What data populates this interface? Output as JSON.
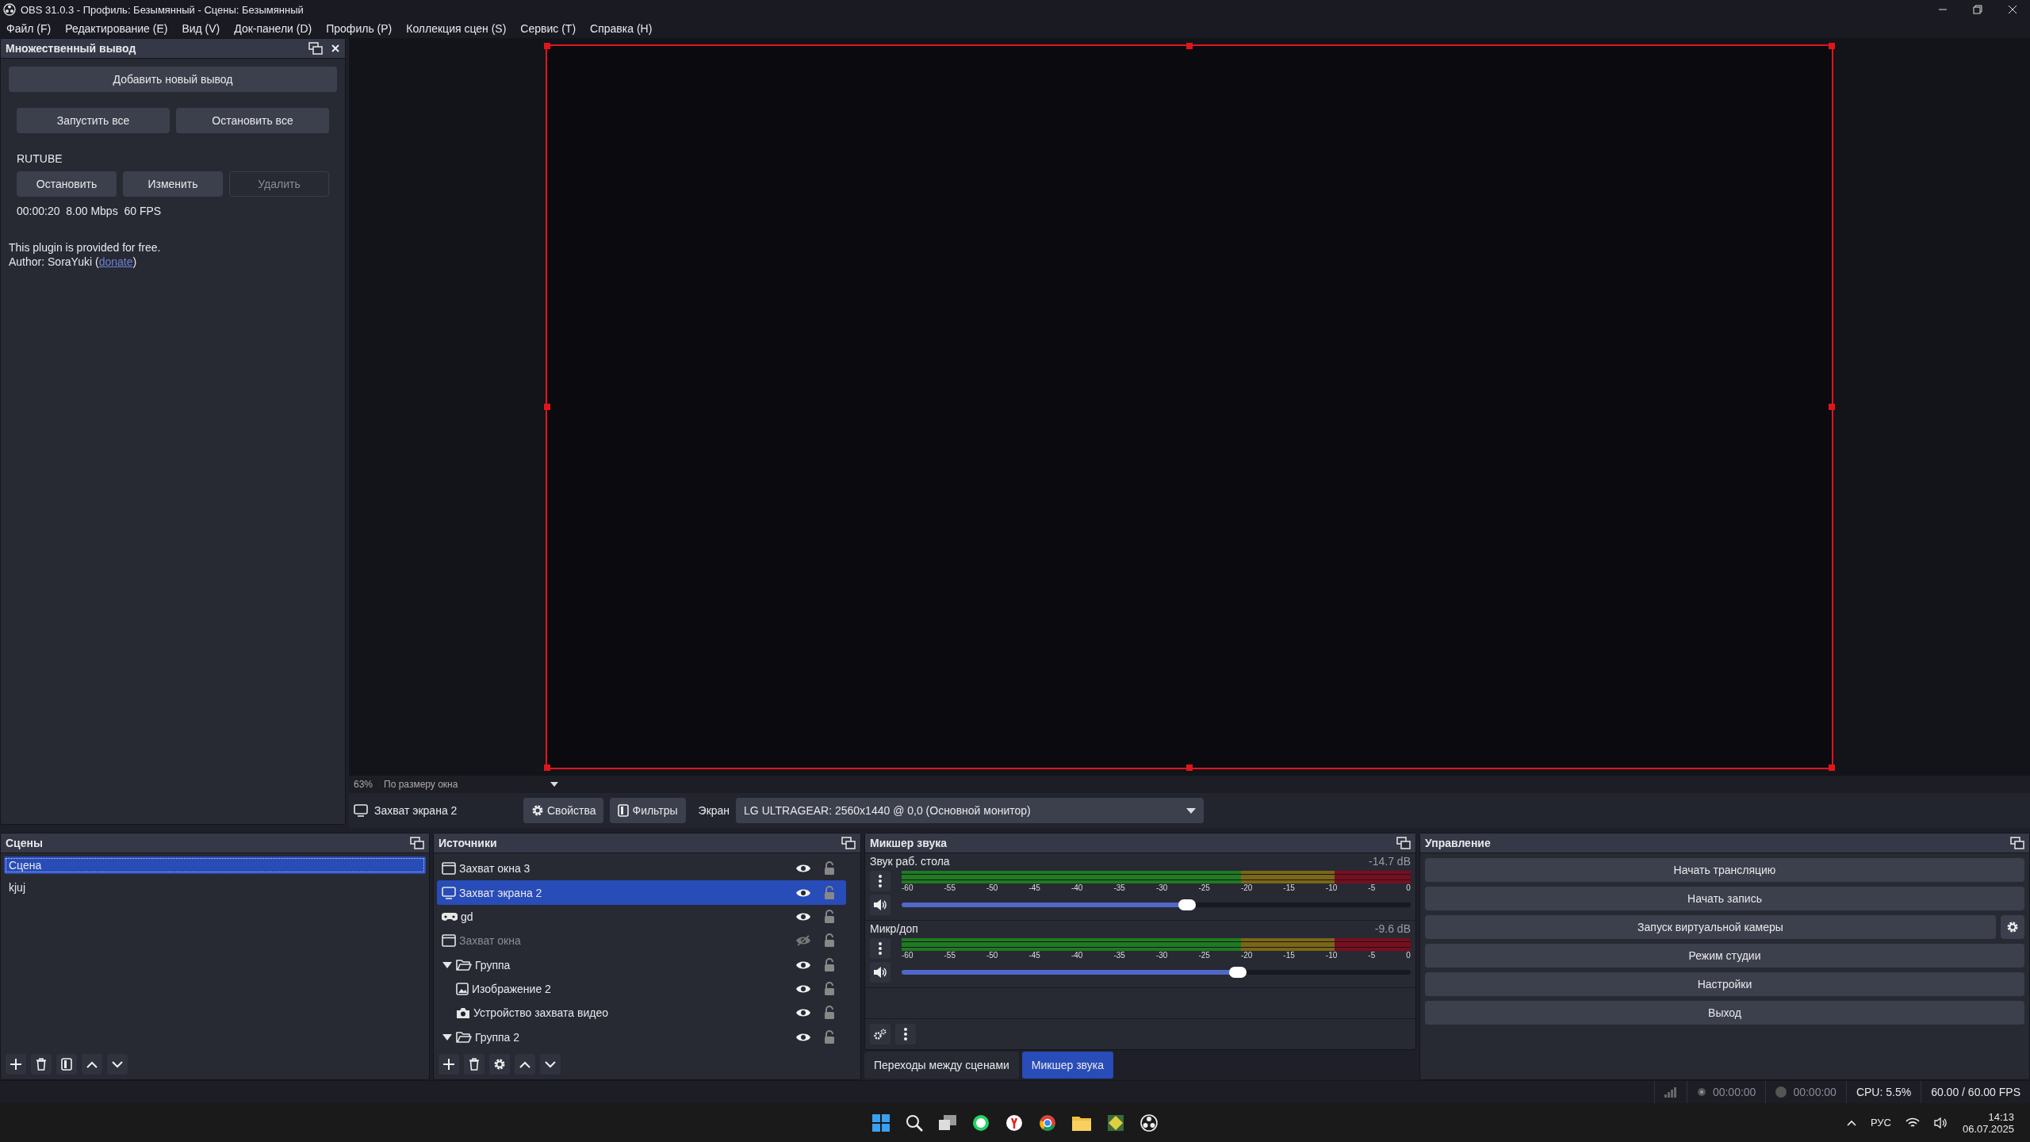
{
  "window": {
    "title": "OBS 31.0.3 - Профиль: Безымянный - Сцены: Безымянный"
  },
  "menu": [
    "Файл (F)",
    "Редактирование (E)",
    "Вид (V)",
    "Док-панели (D)",
    "Профиль (P)",
    "Коллекция сцен (S)",
    "Сервис (T)",
    "Справка (H)"
  ],
  "multi_output": {
    "title": "Множественный вывод",
    "add_button": "Добавить новый вывод",
    "start_all": "Запустить все",
    "stop_all": "Остановить все",
    "targets": [
      {
        "name": "RUTUBE",
        "buttons": [
          {
            "label": "Остановить",
            "disabled": false
          },
          {
            "label": "Изменить",
            "disabled": false
          },
          {
            "label": "Удалить",
            "disabled": true
          }
        ],
        "stats": "00:00:20  8.00 Mbps  60 FPS"
      }
    ],
    "info": "This plugin is provided for free.",
    "author_prefix": "Author: SoraYuki (",
    "author_link": "donate",
    "author_suffix": ")"
  },
  "preview": {
    "zoom": "63%",
    "scale_mode": "По размеру окна"
  },
  "source_toolbar": {
    "source_name": "Захват экрана 2",
    "properties": "Свойства",
    "filters": "Фильтры",
    "label": "Экран",
    "display": "LG ULTRAGEAR: 2560x1440 @ 0,0 (Основной монитор)"
  },
  "scenes": {
    "title": "Сцены",
    "items": [
      {
        "name": "Сцена",
        "selected": true
      },
      {
        "name": "kjuj",
        "selected": false
      }
    ]
  },
  "sources": {
    "title": "Источники",
    "items": [
      {
        "name": "Захват окна 3",
        "kind": "window",
        "visible": true,
        "selected": false
      },
      {
        "name": "Захват экрана 2",
        "kind": "display",
        "visible": true,
        "selected": true
      },
      {
        "name": "gd",
        "kind": "game",
        "visible": true,
        "selected": false
      },
      {
        "name": "Захват окна",
        "kind": "window",
        "visible": false,
        "selected": false
      },
      {
        "name": "Группа",
        "kind": "group",
        "visible": true,
        "selected": false,
        "expanded": true,
        "children": [
          {
            "name": "Изображение 2",
            "kind": "image",
            "visible": true,
            "selected": false
          },
          {
            "name": "Устройство захвата видео",
            "kind": "camera",
            "visible": true,
            "selected": false
          }
        ]
      },
      {
        "name": "Группа 2",
        "kind": "group",
        "visible": true,
        "selected": false,
        "expanded": true
      }
    ]
  },
  "mixer": {
    "title": "Микшер звука",
    "channels": [
      {
        "name": "Звук раб. стола",
        "reading": "-14.7 dB",
        "level": 0.56,
        "scale": [
          "-60",
          "-55",
          "-50",
          "-45",
          "-40",
          "-35",
          "-30",
          "-25",
          "-20",
          "-15",
          "-10",
          "-5",
          "0"
        ]
      },
      {
        "name": "Микр/доп",
        "reading": "-9.6 dB",
        "level": 0.66,
        "scale": [
          "-60",
          "-55",
          "-50",
          "-45",
          "-40",
          "-35",
          "-30",
          "-25",
          "-20",
          "-15",
          "-10",
          "-5",
          "0"
        ]
      }
    ],
    "tabs": [
      {
        "label": "Переходы между сценами",
        "selected": false
      },
      {
        "label": "Микшер звука",
        "selected": true
      }
    ]
  },
  "controls": {
    "title": "Управление",
    "buttons": [
      {
        "label": "Начать трансляцию",
        "kind": "plain"
      },
      {
        "label": "Начать запись",
        "kind": "plain"
      },
      {
        "label": "Запуск виртуальной камеры",
        "kind": "with_settings"
      },
      {
        "label": "Режим студии",
        "kind": "plain"
      },
      {
        "label": "Настройки",
        "kind": "plain"
      },
      {
        "label": "Выход",
        "kind": "plain"
      }
    ]
  },
  "status_bar": {
    "stream_time": "00:00:00",
    "record_time": "00:00:00",
    "cpu": "CPU: 5.5%",
    "fps": "60.00 / 60.00 FPS"
  },
  "taskbar": {
    "language": "РУС",
    "time": "14:13",
    "date": "06.07.2025"
  }
}
